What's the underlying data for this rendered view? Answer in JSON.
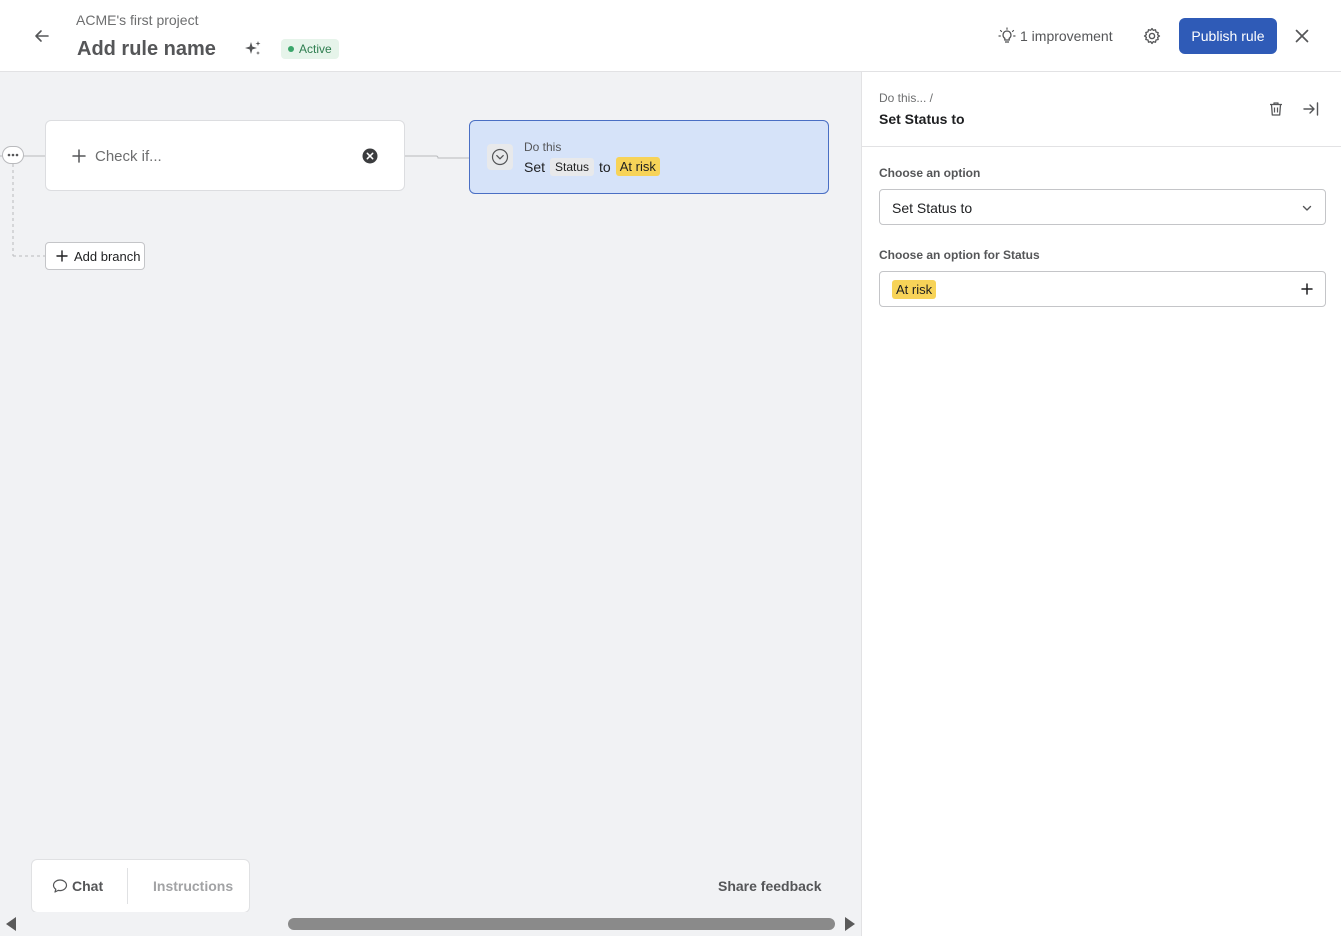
{
  "header": {
    "project_name": "ACME's first project",
    "rule_name": "Add rule name",
    "status": "Active",
    "improvement": "1 improvement",
    "publish_label": "Publish rule"
  },
  "canvas": {
    "check_card": {
      "label": "Check if..."
    },
    "do_card": {
      "title": "Do this",
      "set_word": "Set",
      "field": "Status",
      "to_word": "to",
      "value": "At risk"
    },
    "add_branch_label": "Add branch"
  },
  "footer": {
    "chat_label": "Chat",
    "instructions_label": "Instructions",
    "feedback_label": "Share feedback"
  },
  "panel": {
    "breadcrumb": "Do this...  /",
    "title": "Set Status to",
    "option_label": "Choose an option",
    "option_value": "Set Status to",
    "status_label": "Choose an option for Status",
    "status_value": "At risk"
  },
  "colors": {
    "accent": "#2f5bb7",
    "selected_card": "#d6e3f9",
    "at_risk": "#f7d358",
    "active_badge": "#e6f4ea"
  }
}
